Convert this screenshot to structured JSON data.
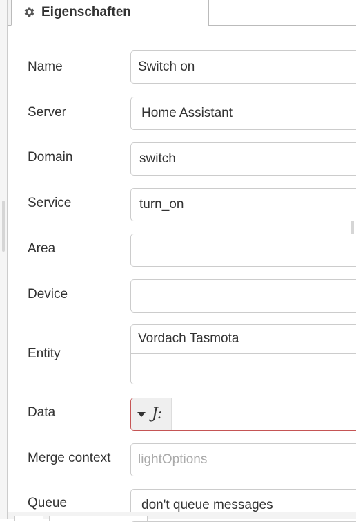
{
  "tabs": [
    {
      "label": "Eigenschaften",
      "icon": "gear-icon",
      "active": true
    },
    {
      "label": "",
      "active": false
    }
  ],
  "form": {
    "name": {
      "label": "Name",
      "value": "Switch on"
    },
    "server": {
      "label": "Server",
      "value": "Home Assistant"
    },
    "domain": {
      "label": "Domain",
      "value": "switch"
    },
    "service": {
      "label": "Service",
      "value": "turn_on"
    },
    "area": {
      "label": "Area",
      "value": ""
    },
    "device": {
      "label": "Device",
      "value": ""
    },
    "entity": {
      "label": "Entity",
      "chip": "Vordach Tasmota"
    },
    "data": {
      "label": "Data",
      "value": "",
      "type_icon": "json-icon"
    },
    "merge_context": {
      "label": "Merge context",
      "placeholder": "lightOptions"
    },
    "queue": {
      "label": "Queue",
      "value": "don't queue messages"
    }
  },
  "colors": {
    "error_border": "#c55555",
    "field_border": "#cccccc",
    "placeholder": "#aaaaaa"
  }
}
